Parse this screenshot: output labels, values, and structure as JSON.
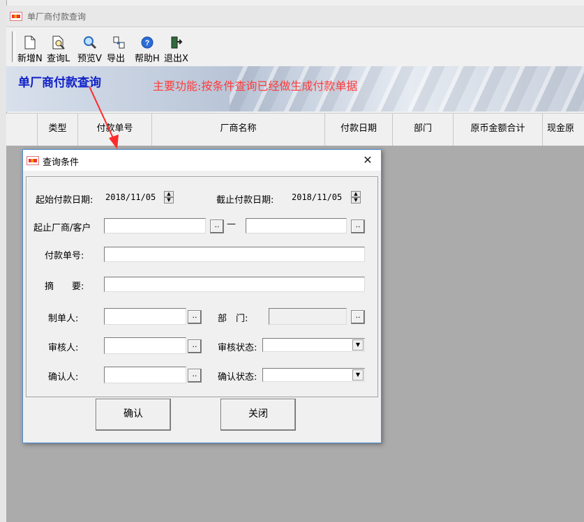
{
  "window": {
    "title": "单厂商付款查询"
  },
  "toolbar": {
    "buttons": [
      {
        "label": "新增N",
        "icon": "new-document-icon"
      },
      {
        "label": "查询L",
        "icon": "search-document-icon"
      },
      {
        "label": "预览V",
        "icon": "magnifier-icon"
      },
      {
        "label": "导出",
        "icon": "export-icon"
      },
      {
        "label": "帮助H",
        "icon": "help-icon"
      },
      {
        "label": "退出X",
        "icon": "exit-icon"
      }
    ]
  },
  "banner": {
    "title": "单厂商付款查询",
    "subtitle": "主要功能:按条件查询已经做生成付款单据"
  },
  "grid": {
    "columns": [
      "类型",
      "付款单号",
      "厂商名称",
      "付款日期",
      "部门",
      "原币金额合计",
      "现金原"
    ]
  },
  "dialog": {
    "title": "查询条件",
    "close_glyph": "✕",
    "start_date_label": "起始付款日期:",
    "start_date_value": "2018/11/05",
    "end_date_label": "截止付款日期:",
    "end_date_value": "2018/11/05",
    "vendor_label": "起止厂商/客户",
    "vendor_from": "",
    "vendor_to": "",
    "range_dash": "—",
    "dots": "..",
    "payment_no_label": "付款单号:",
    "payment_no_value": "",
    "summary_label": "摘　　要:",
    "summary_value": "",
    "maker_label": "制单人:",
    "maker_value": "",
    "dept_label": "部　门:",
    "dept_value": "",
    "reviewer_label": "审核人:",
    "reviewer_value": "",
    "review_status_label": "审核状态:",
    "review_status_value": "",
    "confirmer_label": "确认人:",
    "confirmer_value": "",
    "confirm_status_label": "确认状态:",
    "confirm_status_value": "",
    "ok_label": "确认",
    "close_label": "关闭"
  },
  "colors": {
    "banner_title": "#1020c8",
    "banner_subtitle": "#ff3a3a",
    "annotation_arrow": "#ff2a2a",
    "grid_background": "#ababab"
  }
}
